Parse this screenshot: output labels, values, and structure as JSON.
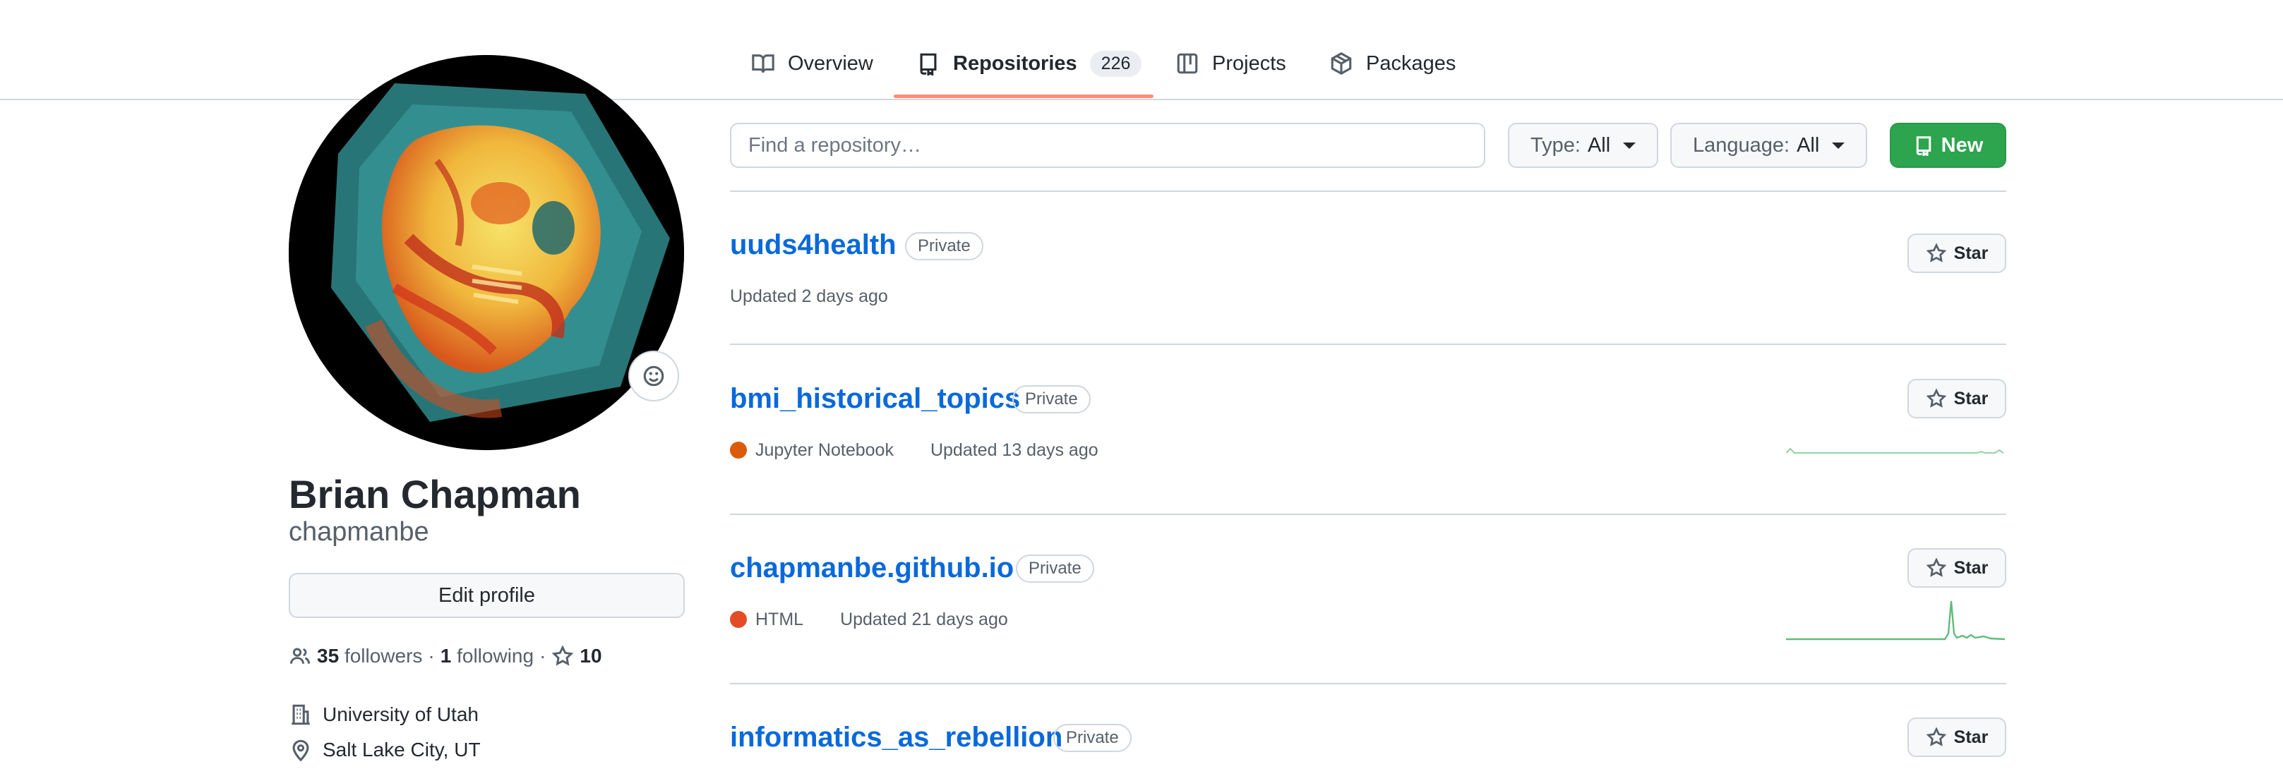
{
  "nav": {
    "tabs": [
      {
        "label": "Overview",
        "icon": "book-icon"
      },
      {
        "label": "Repositories",
        "icon": "repo-icon",
        "count": "226",
        "active": true
      },
      {
        "label": "Projects",
        "icon": "project-icon"
      },
      {
        "label": "Packages",
        "icon": "package-icon"
      }
    ]
  },
  "profile": {
    "full_name": "Brian Chapman",
    "username": "chapmanbe",
    "edit_label": "Edit profile",
    "followers_count": "35",
    "followers_label": "followers",
    "separator": "·",
    "following_count": "1",
    "following_label": "following",
    "stars_count": "10",
    "organization": "University of Utah",
    "location": "Salt Lake City, UT"
  },
  "filters": {
    "search_placeholder": "Find a repository…",
    "type_label": "Type:",
    "type_value": "All",
    "language_label": "Language:",
    "language_value": "All",
    "new_label": "New"
  },
  "repos": [
    {
      "name": "uuds4health",
      "visibility": "Private",
      "language": "",
      "lang_color": "",
      "updated": "Updated 2 days ago",
      "star_label": "Star"
    },
    {
      "name": "bmi_historical_topics",
      "visibility": "Private",
      "language": "Jupyter Notebook",
      "lang_color": "#DA5B0B",
      "updated": "Updated 13 days ago",
      "star_label": "Star"
    },
    {
      "name": "chapmanbe.github.io",
      "visibility": "Private",
      "language": "HTML",
      "lang_color": "#e34c26",
      "updated": "Updated 21 days ago",
      "star_label": "Star"
    },
    {
      "name": "informatics_as_rebellion",
      "visibility": "Private",
      "language": "",
      "lang_color": "",
      "updated": "",
      "star_label": "Star"
    }
  ],
  "colors": {
    "accent": "#0969da",
    "new_button": "#2da44e",
    "tab_underline": "#fd8c73",
    "sparkline": "#2da44e"
  }
}
